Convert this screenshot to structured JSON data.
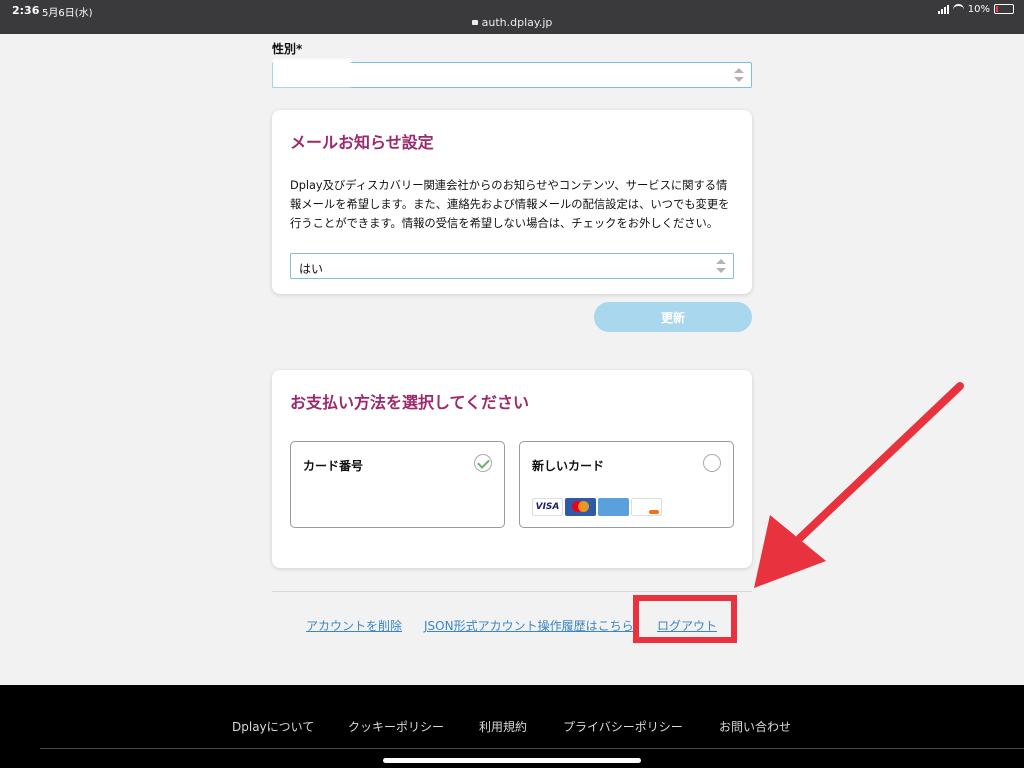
{
  "status_bar": {
    "time": "2:36",
    "date": "5月6日(水)",
    "url": "auth.dplay.jp",
    "battery": "10%"
  },
  "gender": {
    "label": "性別*",
    "value": ""
  },
  "mail_settings": {
    "title": "メールお知らせ設定",
    "description": "Dplay及びディスカバリー関連会社からのお知らせやコンテンツ、サービスに関する情報メールを希望します。また、連絡先および情報メールの配信設定は、いつでも変更を行うことができます。情報の受信を希望しない場合は、チェックをお外しください。",
    "selected": "はい"
  },
  "update_button": "更新",
  "payment": {
    "title": "お支払い方法を選択してください",
    "options": [
      {
        "label": "カード番号",
        "selected": true
      },
      {
        "label": "新しいカード",
        "selected": false
      }
    ],
    "brands": [
      "VISA",
      "MasterCard",
      "AMERICAN EXPRESS",
      "DISCOVER"
    ]
  },
  "account_links": {
    "delete": "アカウントを削除",
    "json_history": "JSON形式アカウント操作履歴はこちら",
    "logout": "ログアウト"
  },
  "footer": {
    "links": [
      "Dplayについて",
      "クッキーポリシー",
      "利用規約",
      "プライバシーポリシー",
      "お問い合わせ"
    ]
  },
  "colors": {
    "heading": "#9c2a6a",
    "link": "#3a86c4",
    "button": "#a9d7ee",
    "annotation": "#e8333e",
    "check": "#66b36e"
  }
}
